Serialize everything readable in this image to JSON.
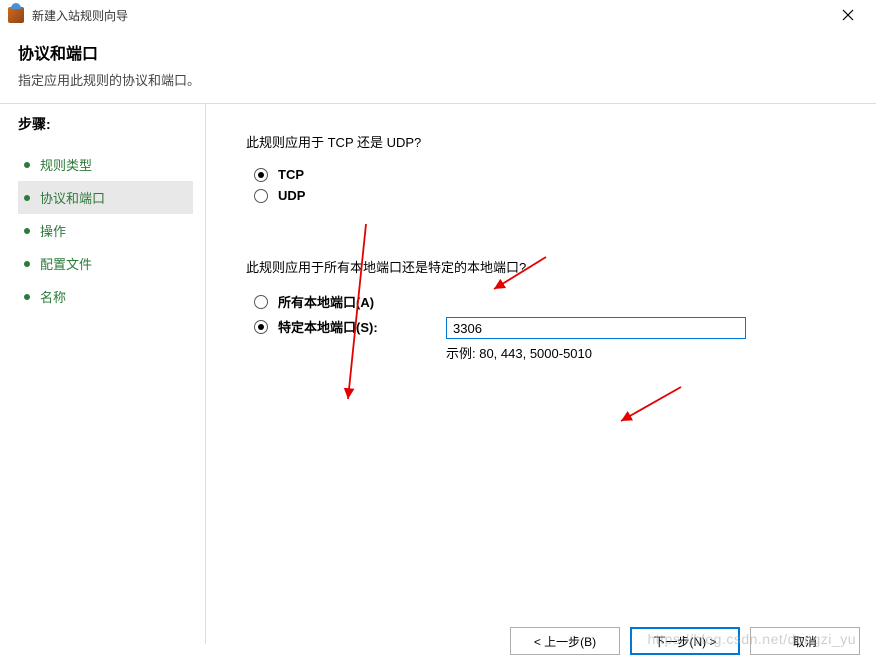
{
  "titlebar": {
    "title": "新建入站规则向导"
  },
  "header": {
    "title": "协议和端口",
    "subtitle": "指定应用此规则的协议和端口。"
  },
  "sidebar": {
    "stepsLabel": "步骤:",
    "items": [
      {
        "label": "规则类型"
      },
      {
        "label": "协议和端口"
      },
      {
        "label": "操作"
      },
      {
        "label": "配置文件"
      },
      {
        "label": "名称"
      }
    ]
  },
  "main": {
    "protocolQuestion": "此规则应用于 TCP 还是 UDP?",
    "tcpLabel": "TCP",
    "udpLabel": "UDP",
    "portQuestion": "此规则应用于所有本地端口还是特定的本地端口?",
    "allPortsLabel": "所有本地端口(A)",
    "specificPortsLabel": "特定本地端口(S):",
    "portValue": "3306",
    "exampleText": "示例: 80, 443, 5000-5010"
  },
  "footer": {
    "back": "< 上一步(B)",
    "next": "下一步(N) >",
    "cancel": "取消"
  },
  "watermark": "https://blog.csdn.net/dongzi_yu"
}
